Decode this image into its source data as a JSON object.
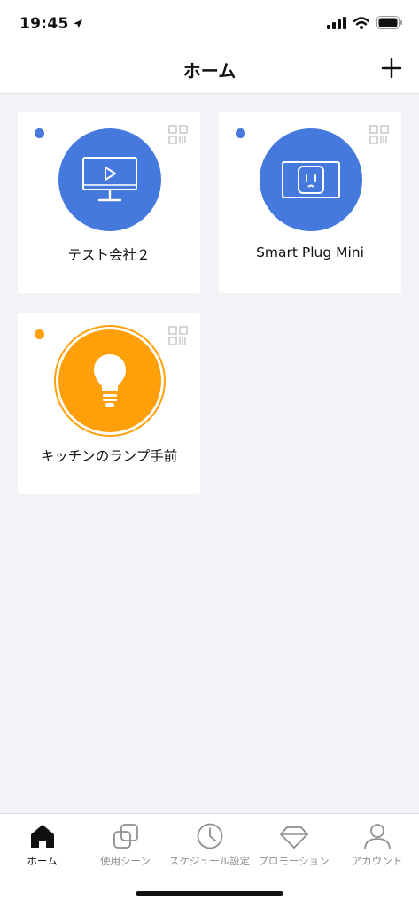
{
  "status_bar": {
    "time": "19:45"
  },
  "nav": {
    "title": "ホーム",
    "add_icon": "plus-icon"
  },
  "colors": {
    "blue": "#4579de",
    "orange": "#ff9f0a",
    "background": "#f2f2f7"
  },
  "devices": [
    {
      "name": "テスト会社２",
      "icon": "tv-icon",
      "status_color": "#4579de"
    },
    {
      "name": "Smart Plug Mini",
      "icon": "plug-icon",
      "status_color": "#4579de"
    },
    {
      "name": "キッチンのランプ手前",
      "icon": "bulb-icon",
      "status_color": "#ff9f0a"
    }
  ],
  "tabs": [
    {
      "label": "ホーム",
      "icon": "home-icon",
      "active": true
    },
    {
      "label": "使用シーン",
      "icon": "scenes-icon",
      "active": false
    },
    {
      "label": "スケジュール設定",
      "icon": "clock-icon",
      "active": false
    },
    {
      "label": "プロモーション",
      "icon": "diamond-icon",
      "active": false
    },
    {
      "label": "アカウント",
      "icon": "person-icon",
      "active": false
    }
  ]
}
